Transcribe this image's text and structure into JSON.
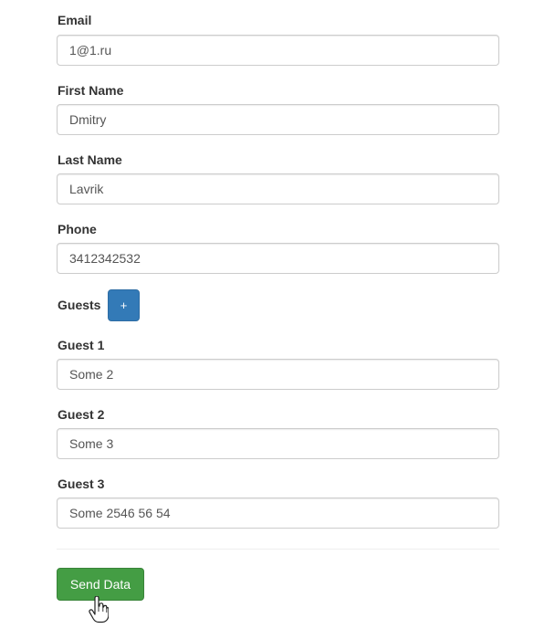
{
  "form": {
    "email": {
      "label": "Email",
      "value": "1@1.ru"
    },
    "first_name": {
      "label": "First Name",
      "value": "Dmitry"
    },
    "last_name": {
      "label": "Last Name",
      "value": "Lavrik"
    },
    "phone": {
      "label": "Phone",
      "value": "3412342532"
    },
    "guests": {
      "label": "Guests",
      "add_label": "+",
      "items": [
        {
          "label": "Guest 1",
          "value": "Some 2"
        },
        {
          "label": "Guest 2",
          "value": "Some 3"
        },
        {
          "label": "Guest 3",
          "value": "Some 2546 56 54"
        }
      ]
    },
    "submit_label": "Send Data"
  },
  "colors": {
    "primary": "#337ab7",
    "success": "#449d44",
    "border": "#cccccc"
  },
  "icons": {
    "cursor": "hand-pointer-icon"
  }
}
